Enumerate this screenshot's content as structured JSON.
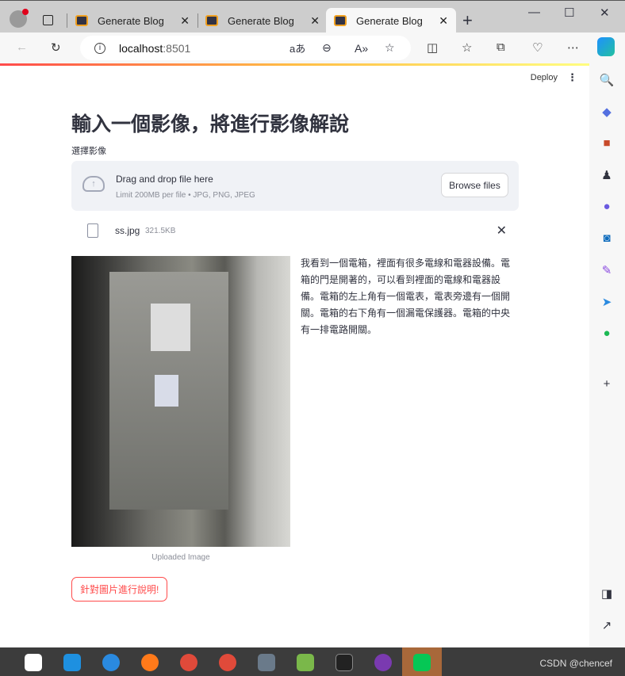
{
  "browser": {
    "tabs": [
      {
        "title": "Generate Blog",
        "active": false
      },
      {
        "title": "Generate Blog",
        "active": false
      },
      {
        "title": "Generate Blog",
        "active": true
      }
    ],
    "url_host": "localhost",
    "url_port": ":8501",
    "toolbar_icons": [
      "read-aloud-icon",
      "zoom-out-icon",
      "translate-icon",
      "favorite-icon",
      "split-screen-icon",
      "favorites-icon",
      "collections-icon",
      "browser-essentials-icon",
      "more-icon",
      "copilot-icon"
    ]
  },
  "app": {
    "deploy": "Deploy",
    "title": "輸入一個影像，將進行影像解說",
    "uploader_label": "選擇影像",
    "drop_title": "Drag and drop file here",
    "drop_hint": "Limit 200MB per file • JPG, PNG, JPEG",
    "browse": "Browse files",
    "file_name": "ss.jpg",
    "file_size": "321.5KB",
    "image_caption": "Uploaded Image",
    "description": "我看到一個電箱，裡面有很多電線和電器設備。電箱的門是開著的，可以看到裡面的電線和電器設備。電箱的左上角有一個電表，電表旁邊有一個開關。電箱的右下角有一個漏電保護器。電箱的中央有一排電路開關。",
    "action_button": "針對圖片進行說明!",
    "accent": "#ff4b4b"
  },
  "taskbar": {
    "watermark": "CSDN @chencef"
  }
}
